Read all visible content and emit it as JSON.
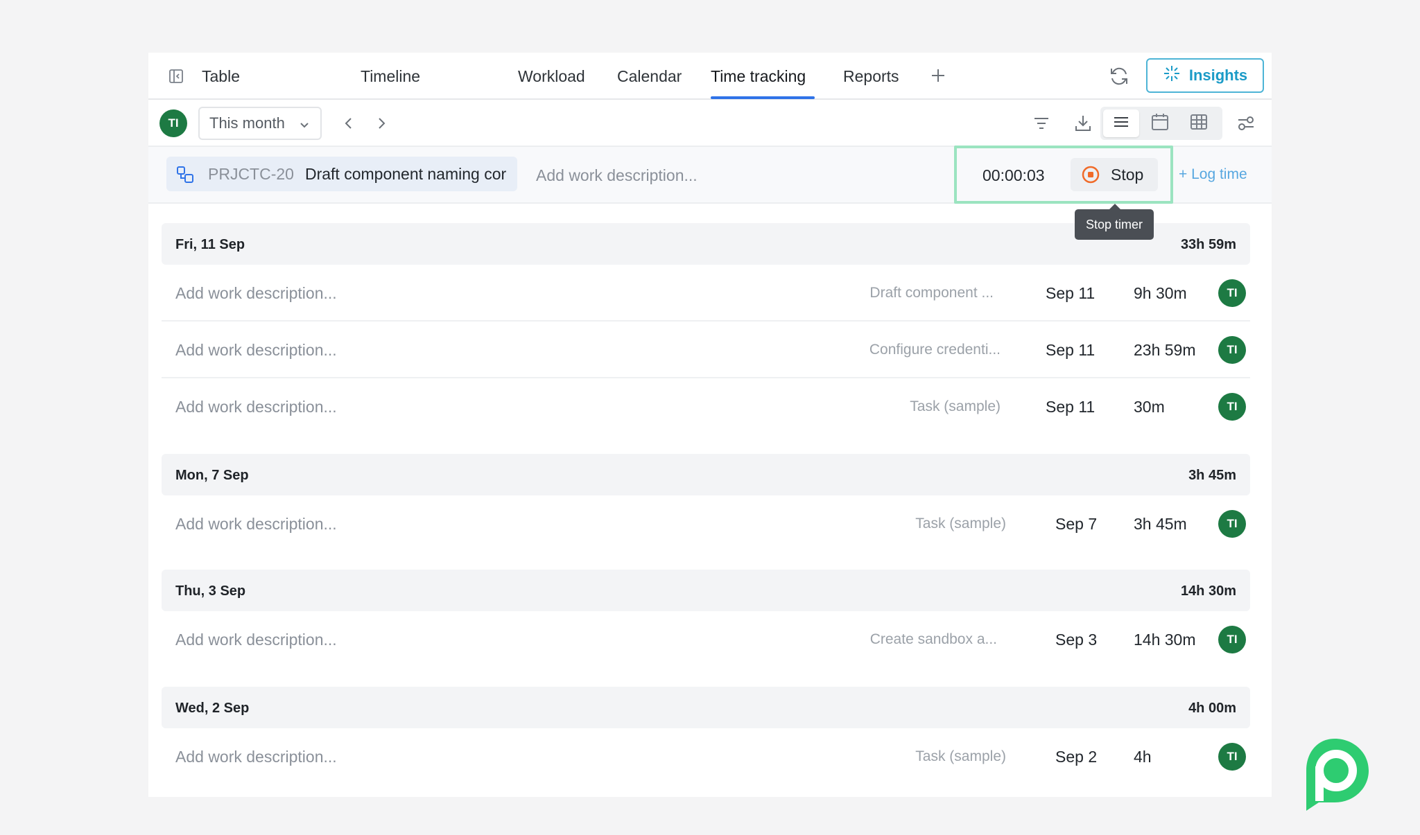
{
  "tabs": [
    {
      "label": "Table",
      "active": false
    },
    {
      "label": "Timeline",
      "active": false
    },
    {
      "label": "Workload",
      "active": false
    },
    {
      "label": "Calendar",
      "active": false
    },
    {
      "label": "Time tracking",
      "active": true
    },
    {
      "label": "Reports",
      "active": false
    }
  ],
  "header": {
    "insights_label": "Insights"
  },
  "toolbar": {
    "user_initials": "TI",
    "period": "This month"
  },
  "timer": {
    "task_key": "PRJCTC-20",
    "task_name": "Draft component naming cor",
    "description_placeholder": "Add work description...",
    "elapsed": "00:00:03",
    "stop_label": "Stop",
    "log_time_label": "+ Log time",
    "tooltip": "Stop timer"
  },
  "groups": [
    {
      "date": "Fri, 11 Sep",
      "total": "33h 59m",
      "entries": [
        {
          "description": "Add work description...",
          "task": "Draft component ...",
          "date": "Sep 11",
          "duration": "9h 30m",
          "user": "TI"
        },
        {
          "description": "Add work description...",
          "task": "Configure credenti...",
          "date": "Sep 11",
          "duration": "23h 59m",
          "user": "TI"
        },
        {
          "description": "Add work description...",
          "task": "Task (sample)",
          "date": "Sep 11",
          "duration": "30m",
          "user": "TI"
        }
      ]
    },
    {
      "date": "Mon, 7 Sep",
      "total": "3h 45m",
      "entries": [
        {
          "description": "Add work description...",
          "task": "Task (sample)",
          "date": "Sep 7",
          "duration": "3h 45m",
          "user": "TI"
        }
      ]
    },
    {
      "date": "Thu, 3 Sep",
      "total": "14h 30m",
      "entries": [
        {
          "description": "Add work description...",
          "task": "Create sandbox a...",
          "date": "Sep 3",
          "duration": "14h 30m",
          "user": "TI"
        }
      ]
    },
    {
      "date": "Wed, 2 Sep",
      "total": "4h 00m",
      "entries": [
        {
          "description": "Add work description...",
          "task": "Task (sample)",
          "date": "Sep 2",
          "duration": "4h",
          "user": "TI"
        }
      ]
    }
  ],
  "colors": {
    "accent": "#2f73e8",
    "insights": "#1b9bc7",
    "avatar": "#1d7a43",
    "stop": "#f06a28",
    "timer_highlight": "#9be4c0",
    "brand": "#2ecc71"
  }
}
